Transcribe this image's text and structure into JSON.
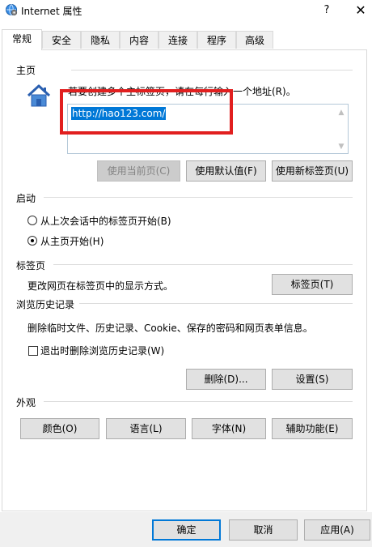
{
  "window": {
    "title": "Internet 属性",
    "help_label": "?",
    "close_label": "✕"
  },
  "tabs": [
    "常规",
    "安全",
    "隐私",
    "内容",
    "连接",
    "程序",
    "高级"
  ],
  "homepage": {
    "group_label": "主页",
    "description": "若要创建多个主标签页，请在每行输入一个地址(R)。",
    "url_value": "http://hao123.com/",
    "buttons": {
      "use_current": "使用当前页(C)",
      "use_default": "使用默认值(F)",
      "use_new_tab": "使用新标签页(U)"
    }
  },
  "startup": {
    "group_label": "启动",
    "option_last_session": "从上次会话中的标签页开始(B)",
    "option_homepage": "从主页开始(H)",
    "selected": "homepage"
  },
  "tabs_group": {
    "group_label": "标签页",
    "description": "更改网页在标签页中的显示方式。",
    "button": "标签页(T)"
  },
  "history": {
    "group_label": "浏览历史记录",
    "description": "删除临时文件、历史记录、Cookie、保存的密码和网页表单信息。",
    "checkbox_label": "退出时删除浏览历史记录(W)",
    "checkbox_checked": false,
    "delete_button": "删除(D)...",
    "settings_button": "设置(S)"
  },
  "appearance": {
    "group_label": "外观",
    "colors_button": "颜色(O)",
    "languages_button": "语言(L)",
    "fonts_button": "字体(N)",
    "accessibility_button": "辅助功能(E)"
  },
  "footer": {
    "ok": "确定",
    "cancel": "取消",
    "apply": "应用(A)"
  }
}
